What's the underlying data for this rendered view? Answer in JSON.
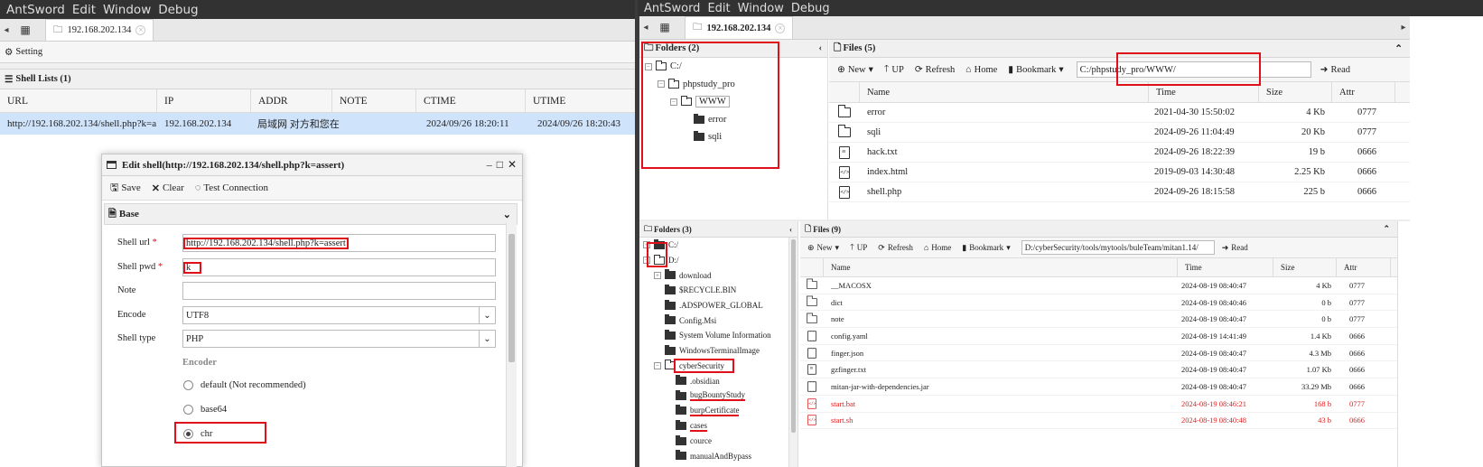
{
  "menu": [
    "AntSword",
    "Edit",
    "Window",
    "Debug"
  ],
  "left": {
    "tab_label": "192.168.202.134",
    "setting_label": "Setting",
    "shell_lists_title": "Shell Lists (1)",
    "columns": [
      "URL",
      "IP",
      "ADDR",
      "NOTE",
      "CTIME",
      "UTIME"
    ],
    "row": [
      "http://192.168.202.134/shell.php?k=a",
      "192.168.202.134",
      "局域网 对方和您在",
      "",
      "2024/09/26 18:20:11",
      "2024/09/26 18:20:43"
    ]
  },
  "dialog": {
    "title": "Edit shell(http://192.168.202.134/shell.php?k=assert)",
    "toolbar": {
      "save": "Save",
      "clear": "Clear",
      "test": "Test Connection"
    },
    "base_label": "Base",
    "shell_url_label": "Shell url",
    "shell_url": "http://192.168.202.134/shell.php?k=assert",
    "shell_pwd_label": "Shell pwd",
    "shell_pwd": "k",
    "note_label": "Note",
    "note": "",
    "encode_label": "Encode",
    "encode": "UTF8",
    "shell_type_label": "Shell type",
    "shell_type": "PHP",
    "encoder_label": "Encoder",
    "encoders": [
      "default (Not recommended)",
      "base64",
      "chr"
    ],
    "selected_encoder": "chr",
    "required_mark": "*"
  },
  "right_top": {
    "tab_label": "192.168.202.134",
    "folders_title": "Folders (2)",
    "tree": [
      {
        "label": "C:/",
        "level": 0,
        "exp": "−"
      },
      {
        "label": "phpstudy_pro",
        "level": 1,
        "exp": "−"
      },
      {
        "label": "WWW",
        "level": 2,
        "exp": "−"
      },
      {
        "label": "error",
        "level": 3,
        "exp": ""
      },
      {
        "label": "sqli",
        "level": 3,
        "exp": ""
      }
    ],
    "files_title": "Files (5)",
    "toolbar": {
      "new": "New",
      "up": "UP",
      "refresh": "Refresh",
      "home": "Home",
      "bookmark": "Bookmark",
      "read": "Read"
    },
    "path": "C:/phpstudy_pro/WWW/",
    "columns": [
      "Name",
      "Time",
      "Size",
      "Attr"
    ],
    "files": [
      {
        "icon": "folder",
        "name": "error",
        "time": "2021-04-30 15:50:02",
        "size": "4 Kb",
        "attr": "0777"
      },
      {
        "icon": "folder",
        "name": "sqli",
        "time": "2024-09-26 11:04:49",
        "size": "20 Kb",
        "attr": "0777"
      },
      {
        "icon": "lines",
        "name": "hack.txt",
        "time": "2024-09-26 18:22:39",
        "size": "19 b",
        "attr": "0666"
      },
      {
        "icon": "code",
        "name": "index.html",
        "time": "2019-09-03 14:30:48",
        "size": "2.25 Kb",
        "attr": "0666"
      },
      {
        "icon": "code",
        "name": "shell.php",
        "time": "2024-09-26 18:15:58",
        "size": "225 b",
        "attr": "0666"
      }
    ]
  },
  "right_bottom": {
    "folders_title": "Folders (3)",
    "tree": [
      {
        "label": "C:/",
        "level": 0,
        "exp": "+",
        "closed": true
      },
      {
        "label": "D:/",
        "level": 0,
        "exp": "−",
        "closed": false
      },
      {
        "label": "download",
        "level": 1,
        "exp": "+",
        "closed": true
      },
      {
        "label": "$RECYCLE.BIN",
        "level": 1,
        "exp": "",
        "closed": true
      },
      {
        "label": ".ADSPOWER_GLOBAL",
        "level": 1,
        "exp": "",
        "closed": true
      },
      {
        "label": "Config.Msi",
        "level": 1,
        "exp": "",
        "closed": true
      },
      {
        "label": "System Volume Information",
        "level": 1,
        "exp": "",
        "closed": true
      },
      {
        "label": "WindowsTerminalImage",
        "level": 1,
        "exp": "",
        "closed": true
      },
      {
        "label": "cyberSecurity",
        "level": 1,
        "exp": "−",
        "closed": false
      },
      {
        "label": ".obsidian",
        "level": 2,
        "exp": "",
        "closed": true
      },
      {
        "label": "bugBountyStudy",
        "level": 2,
        "exp": "",
        "closed": true
      },
      {
        "label": "burpCertificate",
        "level": 2,
        "exp": "",
        "closed": true
      },
      {
        "label": "cases",
        "level": 2,
        "exp": "",
        "closed": true
      },
      {
        "label": "cource",
        "level": 2,
        "exp": "",
        "closed": true
      },
      {
        "label": "manualAndBypass",
        "level": 2,
        "exp": "",
        "closed": true
      }
    ],
    "files_title": "Files (9)",
    "toolbar": {
      "new": "New",
      "up": "UP",
      "refresh": "Refresh",
      "home": "Home",
      "bookmark": "Bookmark",
      "read": "Read"
    },
    "path": "D:/cyberSecurity/tools/mytools/buleTeam/mitan1.14/",
    "columns": [
      "Name",
      "Time",
      "Size",
      "Attr"
    ],
    "files": [
      {
        "icon": "folder",
        "name": "__MACOSX",
        "time": "2024-08-19 08:40:47",
        "size": "4 Kb",
        "attr": "0777",
        "red": false
      },
      {
        "icon": "folder",
        "name": "dict",
        "time": "2024-08-19 08:40:46",
        "size": "0 b",
        "attr": "0777",
        "red": false
      },
      {
        "icon": "folder",
        "name": "note",
        "time": "2024-08-19 08:40:47",
        "size": "0 b",
        "attr": "0777",
        "red": false
      },
      {
        "icon": "doc",
        "name": "config.yaml",
        "time": "2024-08-19 14:41:49",
        "size": "1.4 Kb",
        "attr": "0666",
        "red": false
      },
      {
        "icon": "doc",
        "name": "finger.json",
        "time": "2024-08-19 08:40:47",
        "size": "4.3 Mb",
        "attr": "0666",
        "red": false
      },
      {
        "icon": "lines",
        "name": "gzfinger.txt",
        "time": "2024-08-19 08:40:47",
        "size": "1.07 Kb",
        "attr": "0666",
        "red": false
      },
      {
        "icon": "doc",
        "name": "mitan-jar-with-dependencies.jar",
        "time": "2024-08-19 08:40:47",
        "size": "33.29 Mb",
        "attr": "0666",
        "red": false
      },
      {
        "icon": "code",
        "name": "start.bat",
        "time": "2024-08-19 08:46:21",
        "size": "168 b",
        "attr": "0777",
        "red": true
      },
      {
        "icon": "code",
        "name": "start.sh",
        "time": "2024-08-19 08:40:48",
        "size": "43 b",
        "attr": "0666",
        "red": true
      }
    ]
  },
  "colors": {
    "highlight": "#e0101b",
    "row_selected": "#cfe3fb",
    "menubar": "#323232"
  }
}
